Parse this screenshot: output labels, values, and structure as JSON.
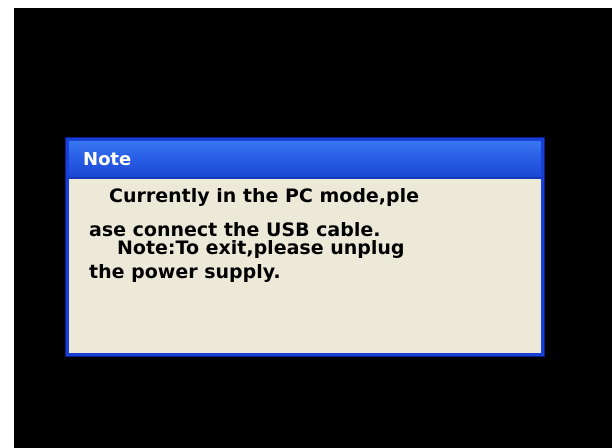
{
  "dialog": {
    "title": "Note",
    "lines": [
      "Currently in the PC mode,ple",
      "ase connect the USB cable.",
      "Note:To exit,please unplug",
      "the power supply."
    ]
  },
  "colors": {
    "screen_background": "#000000",
    "titlebar_blue": "#2a5fe6",
    "dialog_body": "#ece9d8"
  }
}
